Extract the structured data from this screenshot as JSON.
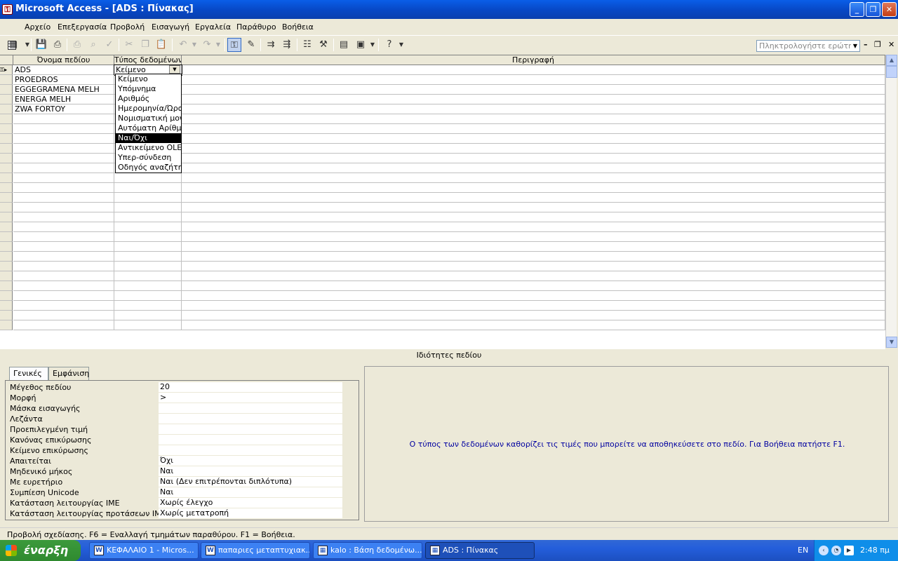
{
  "window": {
    "title": "Microsoft Access - [ADS : Πίνακας]",
    "buttons": {
      "minimize": "_",
      "restore": "❐",
      "close": "✕"
    }
  },
  "menu": {
    "items": [
      "Αρχείο",
      "Επεξεργασία",
      "Προβολή",
      "Εισαγωγή",
      "Εργαλεία",
      "Παράθυρο",
      "Βοήθεια"
    ],
    "ask_placeholder": "Πληκτρολογήστε ερώτηση",
    "doc_controls": {
      "minimize": "–",
      "restore": "❐",
      "close": "✕"
    }
  },
  "toolbar": {
    "icons": [
      "view-icon",
      "save-icon",
      "print-preview-icon",
      "print-icon",
      "spelling-icon",
      "cut-icon",
      "copy-icon",
      "paste-icon",
      "undo-icon",
      "redo-icon",
      "primary-key-icon",
      "builder-icon",
      "insert-rows-icon",
      "delete-rows-icon",
      "properties-icon",
      "build-icon",
      "database-window-icon",
      "new-object-icon",
      "help-icon"
    ]
  },
  "grid": {
    "headers": {
      "field_name": "Όνομα πεδίου",
      "data_type": "Τύπος δεδομένων",
      "description": "Περιγραφή"
    },
    "rows": [
      {
        "field_name": "ADS",
        "data_type": "Κείμενο",
        "description": ""
      },
      {
        "field_name": "PROEDROS",
        "data_type": "",
        "description": ""
      },
      {
        "field_name": "EGGEGRAMENA MELH",
        "data_type": "",
        "description": ""
      },
      {
        "field_name": "ENERGA MELH",
        "data_type": "",
        "description": ""
      },
      {
        "field_name": "ZWA FORTOY",
        "data_type": "",
        "description": ""
      }
    ],
    "empty_row_count": 22
  },
  "data_type_dropdown": {
    "options": [
      "Κείμενο",
      "Υπόμνημα",
      "Αριθμός",
      "Ημερομηνία/Ώρα",
      "Νομισματική μονάδα",
      "Αυτόματη Αρίθμηση",
      "Ναι/Όχι",
      "Αντικείμενο OLE",
      "Υπερ-σύνδεση",
      "Οδηγός αναζήτησης"
    ],
    "highlighted": "Ναι/Όχι"
  },
  "field_properties": {
    "title": "Ιδιότητες πεδίου",
    "tabs": [
      "Γενικές",
      "Εμφάνιση"
    ],
    "active_tab": "Γενικές",
    "rows": [
      {
        "label": "Μέγεθος πεδίου",
        "value": "20"
      },
      {
        "label": "Μορφή",
        "value": ">"
      },
      {
        "label": "Μάσκα εισαγωγής",
        "value": ""
      },
      {
        "label": "Λεζάντα",
        "value": ""
      },
      {
        "label": "Προεπιλεγμένη τιμή",
        "value": ""
      },
      {
        "label": "Κανόνας επικύρωσης",
        "value": ""
      },
      {
        "label": "Κείμενο επικύρωσης",
        "value": ""
      },
      {
        "label": "Απαιτείται",
        "value": "Όχι"
      },
      {
        "label": "Μηδενικό μήκος",
        "value": "Ναι"
      },
      {
        "label": "Με ευρετήριο",
        "value": "Ναι (Δεν επιτρέπονται διπλότυπα)"
      },
      {
        "label": "Συμπίεση Unicode",
        "value": "Ναι"
      },
      {
        "label": "Κατάσταση λειτουργίας IME",
        "value": "Χωρίς έλεγχο"
      },
      {
        "label": "Κατάσταση λειτουργίας προτάσεων IME",
        "value": "Χωρίς μετατροπή"
      }
    ],
    "help_text": "Ο τύπος των δεδομένων καθορίζει τις τιμές που μπορείτε να αποθηκεύσετε στο πεδίο. Για Βοήθεια πατήστε F1."
  },
  "status_bar": {
    "text": "Προβολή σχεδίασης.  F6 = Εναλλαγή τμημάτων παραθύρου.  F1 = Βοήθεια."
  },
  "taskbar": {
    "start_label": "έναρξη",
    "tasks": [
      {
        "label": "ΚΕΦΑΛΑΙΟ 1 - Micros...",
        "icon": "W",
        "active": false
      },
      {
        "label": "παπαριες μεταπτυχιακ...",
        "icon": "W",
        "active": false
      },
      {
        "label": "kalo : Βάση δεδομένω...",
        "icon": "▦",
        "active": false
      },
      {
        "label": "ADS : Πίνακας",
        "icon": "▦",
        "active": true
      }
    ],
    "language": "EN",
    "clock": "2:48 πμ"
  }
}
